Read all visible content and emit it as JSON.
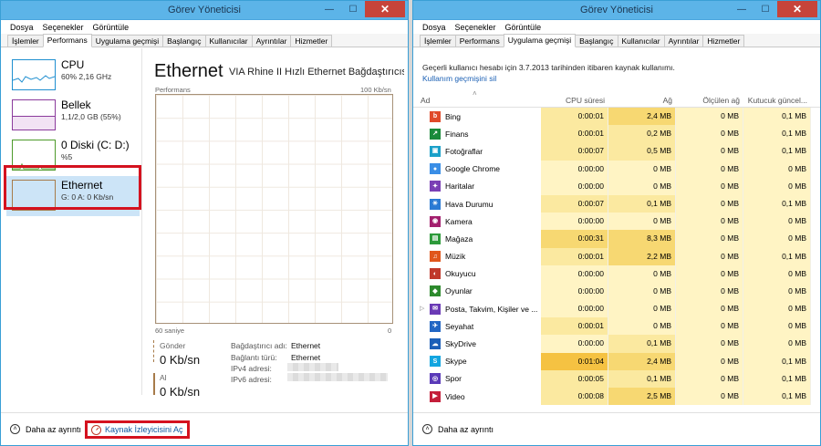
{
  "left": {
    "title": "Görev Yöneticisi",
    "menu": [
      "Dosya",
      "Seçenekler",
      "Görüntüle"
    ],
    "tabs": [
      "İşlemler",
      "Performans",
      "Uygulama geçmişi",
      "Başlangıç",
      "Kullanıcılar",
      "Ayrıntılar",
      "Hizmetler"
    ],
    "active_tab": 1,
    "sidebar": [
      {
        "name": "CPU",
        "sub": "60% 2,16 GHz",
        "color": "#1f8fd0"
      },
      {
        "name": "Bellek",
        "sub": "1,1/2,0 GB (55%)",
        "color": "#8b3b9c"
      },
      {
        "name": "0 Diski (C: D:)",
        "sub": "%5",
        "color": "#4d9a2a"
      },
      {
        "name": "Ethernet",
        "sub": "G: 0 A: 0 Kb/sn",
        "color": "#a77b4a"
      }
    ],
    "panel": {
      "title": "Ethernet",
      "adapter": "VIA Rhine II Hızlı Ethernet Bağdaştırıcısı",
      "graph_top_left": "Performans",
      "graph_top_right": "100 Kb/sn",
      "graph_bottom_left": "60 saniye",
      "graph_bottom_right": "0",
      "send_label": "Gönder",
      "send_value": "0 Kb/sn",
      "recv_label": "Al",
      "recv_value": "0 Kb/sn",
      "kv": [
        {
          "key": "Bağdaştırıcı adı:",
          "value": "Ethernet"
        },
        {
          "key": "Bağlantı türü:",
          "value": "Ethernet"
        },
        {
          "key": "IPv4 adresi:",
          "value": ""
        },
        {
          "key": "IPv6 adresi:",
          "value": ""
        }
      ]
    },
    "footer": {
      "less_details": "Daha az ayrıntı",
      "open_monitor": "Kaynak İzleyicisini Aç"
    }
  },
  "right": {
    "title": "Görev Yöneticisi",
    "menu": [
      "Dosya",
      "Seçenekler",
      "Görüntüle"
    ],
    "tabs": [
      "İşlemler",
      "Performans",
      "Uygulama geçmişi",
      "Başlangıç",
      "Kullanıcılar",
      "Ayrıntılar",
      "Hizmetler"
    ],
    "active_tab": 2,
    "info": "Geçerli kullanıcı hesabı için 3.7.2013 tarihinden itibaren kaynak kullanımı.",
    "clear_link": "Kullanım geçmişini sil",
    "columns": [
      "Ad",
      "CPU süresi",
      "Ağ",
      "Ölçülen ağ",
      "Kutucuk güncel..."
    ],
    "rows": [
      {
        "name": "Bing",
        "cpu": "0:00:01",
        "net": "2,4 MB",
        "metered": "0 MB",
        "tile": "0,1 MB",
        "icon_color": "#e04a2a",
        "glyph": "b",
        "cpu_heat": 1,
        "net_heat": 2
      },
      {
        "name": "Finans",
        "cpu": "0:00:01",
        "net": "0,2 MB",
        "metered": "0 MB",
        "tile": "0,1 MB",
        "icon_color": "#1a8a3a",
        "glyph": "↗",
        "cpu_heat": 1,
        "net_heat": 1
      },
      {
        "name": "Fotoğraflar",
        "cpu": "0:00:07",
        "net": "0,5 MB",
        "metered": "0 MB",
        "tile": "0,1 MB",
        "icon_color": "#1aa0c9",
        "glyph": "▣",
        "cpu_heat": 1,
        "net_heat": 1
      },
      {
        "name": "Google Chrome",
        "cpu": "0:00:00",
        "net": "0 MB",
        "metered": "0 MB",
        "tile": "0 MB",
        "icon_color": "#3a8ee6",
        "glyph": "●",
        "cpu_heat": 0,
        "net_heat": 0
      },
      {
        "name": "Haritalar",
        "cpu": "0:00:00",
        "net": "0 MB",
        "metered": "0 MB",
        "tile": "0 MB",
        "icon_color": "#7a3fb5",
        "glyph": "✦",
        "cpu_heat": 0,
        "net_heat": 0
      },
      {
        "name": "Hava Durumu",
        "cpu": "0:00:07",
        "net": "0,1 MB",
        "metered": "0 MB",
        "tile": "0,1 MB",
        "icon_color": "#2a7ad4",
        "glyph": "☀",
        "cpu_heat": 1,
        "net_heat": 1
      },
      {
        "name": "Kamera",
        "cpu": "0:00:00",
        "net": "0 MB",
        "metered": "0 MB",
        "tile": "0 MB",
        "icon_color": "#a3206e",
        "glyph": "◉",
        "cpu_heat": 0,
        "net_heat": 0
      },
      {
        "name": "Mağaza",
        "cpu": "0:00:31",
        "net": "8,3 MB",
        "metered": "0 MB",
        "tile": "0 MB",
        "icon_color": "#2d9a3a",
        "glyph": "▤",
        "cpu_heat": 2,
        "net_heat": 2
      },
      {
        "name": "Müzik",
        "cpu": "0:00:01",
        "net": "2,2 MB",
        "metered": "0 MB",
        "tile": "0,1 MB",
        "icon_color": "#e0561c",
        "glyph": "♫",
        "cpu_heat": 1,
        "net_heat": 2
      },
      {
        "name": "Okuyucu",
        "cpu": "0:00:00",
        "net": "0 MB",
        "metered": "0 MB",
        "tile": "0 MB",
        "icon_color": "#c0392b",
        "glyph": "◐",
        "cpu_heat": 0,
        "net_heat": 0
      },
      {
        "name": "Oyunlar",
        "cpu": "0:00:00",
        "net": "0 MB",
        "metered": "0 MB",
        "tile": "0 MB",
        "icon_color": "#2d8a2d",
        "glyph": "◆",
        "cpu_heat": 0,
        "net_heat": 0
      },
      {
        "name": "Posta, Takvim, Kişiler ve ...",
        "cpu": "0:00:00",
        "net": "0 MB",
        "metered": "0 MB",
        "tile": "0 MB",
        "icon_color": "#6a3ab5",
        "glyph": "✉",
        "cpu_heat": 0,
        "net_heat": 0,
        "expandable": true
      },
      {
        "name": "Seyahat",
        "cpu": "0:00:01",
        "net": "0 MB",
        "metered": "0 MB",
        "tile": "0 MB",
        "icon_color": "#2266c4",
        "glyph": "✈",
        "cpu_heat": 1,
        "net_heat": 0
      },
      {
        "name": "SkyDrive",
        "cpu": "0:00:00",
        "net": "0,1 MB",
        "metered": "0 MB",
        "tile": "0 MB",
        "icon_color": "#1c5fb8",
        "glyph": "☁",
        "cpu_heat": 0,
        "net_heat": 1
      },
      {
        "name": "Skype",
        "cpu": "0:01:04",
        "net": "2,4 MB",
        "metered": "0 MB",
        "tile": "0,1 MB",
        "icon_color": "#12a5e0",
        "glyph": "S",
        "cpu_heat": 3,
        "net_heat": 2
      },
      {
        "name": "Spor",
        "cpu": "0:00:05",
        "net": "0,1 MB",
        "metered": "0 MB",
        "tile": "0,1 MB",
        "icon_color": "#5a3ab8",
        "glyph": "◎",
        "cpu_heat": 1,
        "net_heat": 1
      },
      {
        "name": "Video",
        "cpu": "0:00:08",
        "net": "2,5 MB",
        "metered": "0 MB",
        "tile": "0,1 MB",
        "icon_color": "#c41e3a",
        "glyph": "▶",
        "cpu_heat": 1,
        "net_heat": 2
      }
    ],
    "footer": {
      "less_details": "Daha az ayrıntı"
    }
  }
}
